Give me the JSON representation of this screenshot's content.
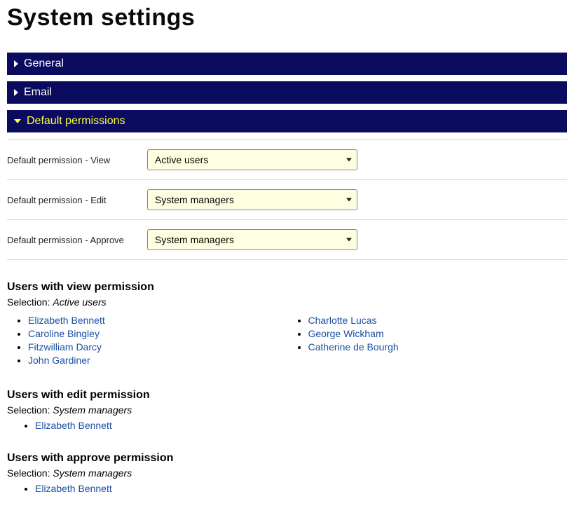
{
  "pageTitle": "System settings",
  "accordion": {
    "general": "General",
    "email": "Email",
    "defaultPermissions": "Default permissions"
  },
  "fields": {
    "view": {
      "label": "Default permission - View",
      "value": "Active users"
    },
    "edit": {
      "label": "Default permission - Edit",
      "value": "System managers"
    },
    "approve": {
      "label": "Default permission - Approve",
      "value": "System managers"
    }
  },
  "selectionLabel": "Selection: ",
  "sections": {
    "view": {
      "heading": "Users with view permission",
      "selection": "Active users",
      "usersCol1": [
        "Elizabeth Bennett",
        "Caroline Bingley",
        "Fitzwilliam Darcy",
        "John Gardiner"
      ],
      "usersCol2": [
        "Charlotte Lucas",
        "George Wickham",
        "Catherine de Bourgh"
      ]
    },
    "edit": {
      "heading": "Users with edit permission",
      "selection": "System managers",
      "users": [
        "Elizabeth Bennett"
      ]
    },
    "approve": {
      "heading": "Users with approve permission",
      "selection": "System managers",
      "users": [
        "Elizabeth Bennett"
      ]
    }
  }
}
